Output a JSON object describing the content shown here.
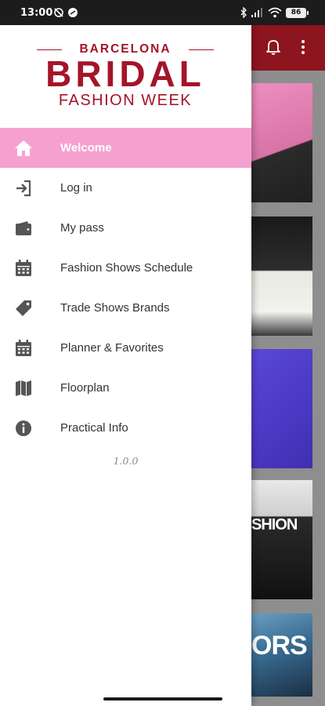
{
  "status_bar": {
    "time": "13:00",
    "battery": "86"
  },
  "brand": {
    "line1": "BARCELONA",
    "line2": "BRIDAL",
    "line3": "FASHION WEEK",
    "color": "#a4142a"
  },
  "menu": {
    "items": [
      {
        "label": "Welcome",
        "icon": "home-icon",
        "active": true
      },
      {
        "label": "Log in",
        "icon": "login-icon",
        "active": false
      },
      {
        "label": "My pass",
        "icon": "wallet-icon",
        "active": false
      },
      {
        "label": "Fashion Shows Schedule",
        "icon": "calendar-icon",
        "active": false
      },
      {
        "label": "Trade Shows Brands",
        "icon": "tag-icon",
        "active": false
      },
      {
        "label": "Planner & Favorites",
        "icon": "calendar-icon",
        "active": false
      },
      {
        "label": "Floorplan",
        "icon": "map-icon",
        "active": false
      },
      {
        "label": "Practical Info",
        "icon": "info-icon",
        "active": false
      }
    ],
    "active_color": "#f5a1d0"
  },
  "version": "1.0.0",
  "background_app": {
    "toolbar_color": "#8d1520",
    "cards": [
      {
        "text": ""
      },
      {
        "text": ""
      },
      {
        "text": ""
      },
      {
        "text": "SHION"
      },
      {
        "text": "ORS"
      }
    ]
  }
}
